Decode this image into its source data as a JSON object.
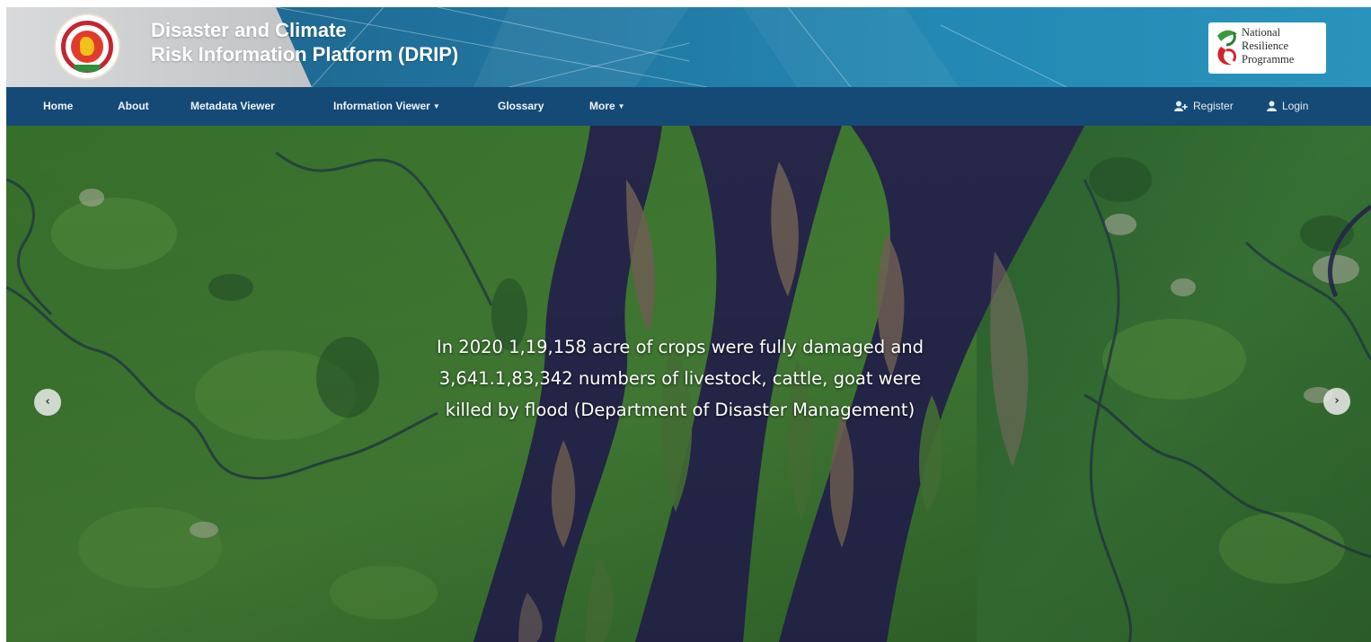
{
  "header": {
    "title_line1": "Disaster and Climate",
    "title_line2": "Risk Information Platform (DRIP)",
    "partner_logo": {
      "line1": "National",
      "line2": "Resilience",
      "line3": "Programme"
    }
  },
  "nav": {
    "items": [
      {
        "label": "Home"
      },
      {
        "label": "About"
      },
      {
        "label": "Metadata Viewer"
      },
      {
        "label": "Information Viewer",
        "dropdown": true
      },
      {
        "label": "Glossary"
      },
      {
        "label": "More",
        "dropdown": true
      }
    ],
    "register_label": "Register",
    "login_label": "Login"
  },
  "hero": {
    "caption_line1": "In 2020 1,19,158 acre of crops were fully damaged and",
    "caption_line2": "3,641.1,83,342 numbers of livestock, cattle, goat were",
    "caption_line3": "killed by flood (Department of Disaster Management)",
    "prev_icon": "chevron-left-icon",
    "next_icon": "chevron-right-icon"
  },
  "colors": {
    "navbar": "#144a75",
    "banner": "#20739e",
    "river": "#2a2a52",
    "land": "#3f7d36"
  }
}
